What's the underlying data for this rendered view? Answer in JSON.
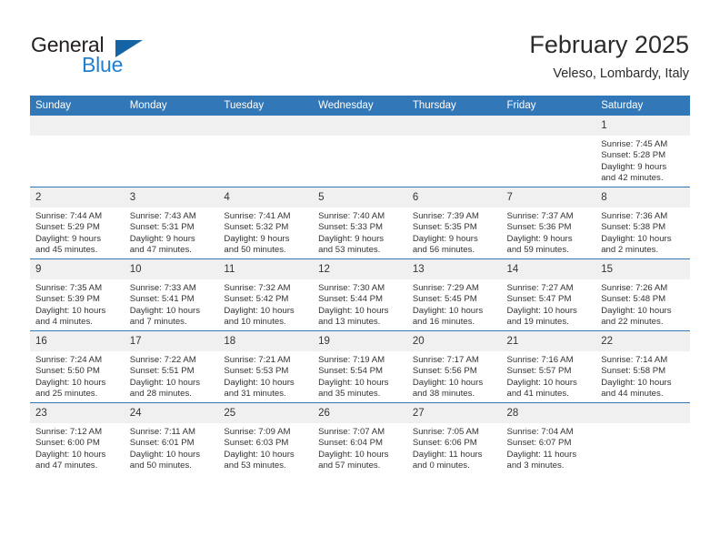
{
  "brand": {
    "name_top": "General",
    "name_bottom": "Blue",
    "triangle_color": "#1464a5",
    "blue_color": "#1f7fd0"
  },
  "header": {
    "title": "February 2025",
    "location": "Veleso, Lombardy, Italy",
    "header_bg": "#3277b8",
    "daynum_bg": "#f0f0f0"
  },
  "weekdays": [
    "Sunday",
    "Monday",
    "Tuesday",
    "Wednesday",
    "Thursday",
    "Friday",
    "Saturday"
  ],
  "weeks": [
    [
      {
        "day": "",
        "lines": []
      },
      {
        "day": "",
        "lines": []
      },
      {
        "day": "",
        "lines": []
      },
      {
        "day": "",
        "lines": []
      },
      {
        "day": "",
        "lines": []
      },
      {
        "day": "",
        "lines": []
      },
      {
        "day": "1",
        "lines": [
          "Sunrise: 7:45 AM",
          "Sunset: 5:28 PM",
          "Daylight: 9 hours",
          "and 42 minutes."
        ]
      }
    ],
    [
      {
        "day": "2",
        "lines": [
          "Sunrise: 7:44 AM",
          "Sunset: 5:29 PM",
          "Daylight: 9 hours",
          "and 45 minutes."
        ]
      },
      {
        "day": "3",
        "lines": [
          "Sunrise: 7:43 AM",
          "Sunset: 5:31 PM",
          "Daylight: 9 hours",
          "and 47 minutes."
        ]
      },
      {
        "day": "4",
        "lines": [
          "Sunrise: 7:41 AM",
          "Sunset: 5:32 PM",
          "Daylight: 9 hours",
          "and 50 minutes."
        ]
      },
      {
        "day": "5",
        "lines": [
          "Sunrise: 7:40 AM",
          "Sunset: 5:33 PM",
          "Daylight: 9 hours",
          "and 53 minutes."
        ]
      },
      {
        "day": "6",
        "lines": [
          "Sunrise: 7:39 AM",
          "Sunset: 5:35 PM",
          "Daylight: 9 hours",
          "and 56 minutes."
        ]
      },
      {
        "day": "7",
        "lines": [
          "Sunrise: 7:37 AM",
          "Sunset: 5:36 PM",
          "Daylight: 9 hours",
          "and 59 minutes."
        ]
      },
      {
        "day": "8",
        "lines": [
          "Sunrise: 7:36 AM",
          "Sunset: 5:38 PM",
          "Daylight: 10 hours",
          "and 2 minutes."
        ]
      }
    ],
    [
      {
        "day": "9",
        "lines": [
          "Sunrise: 7:35 AM",
          "Sunset: 5:39 PM",
          "Daylight: 10 hours",
          "and 4 minutes."
        ]
      },
      {
        "day": "10",
        "lines": [
          "Sunrise: 7:33 AM",
          "Sunset: 5:41 PM",
          "Daylight: 10 hours",
          "and 7 minutes."
        ]
      },
      {
        "day": "11",
        "lines": [
          "Sunrise: 7:32 AM",
          "Sunset: 5:42 PM",
          "Daylight: 10 hours",
          "and 10 minutes."
        ]
      },
      {
        "day": "12",
        "lines": [
          "Sunrise: 7:30 AM",
          "Sunset: 5:44 PM",
          "Daylight: 10 hours",
          "and 13 minutes."
        ]
      },
      {
        "day": "13",
        "lines": [
          "Sunrise: 7:29 AM",
          "Sunset: 5:45 PM",
          "Daylight: 10 hours",
          "and 16 minutes."
        ]
      },
      {
        "day": "14",
        "lines": [
          "Sunrise: 7:27 AM",
          "Sunset: 5:47 PM",
          "Daylight: 10 hours",
          "and 19 minutes."
        ]
      },
      {
        "day": "15",
        "lines": [
          "Sunrise: 7:26 AM",
          "Sunset: 5:48 PM",
          "Daylight: 10 hours",
          "and 22 minutes."
        ]
      }
    ],
    [
      {
        "day": "16",
        "lines": [
          "Sunrise: 7:24 AM",
          "Sunset: 5:50 PM",
          "Daylight: 10 hours",
          "and 25 minutes."
        ]
      },
      {
        "day": "17",
        "lines": [
          "Sunrise: 7:22 AM",
          "Sunset: 5:51 PM",
          "Daylight: 10 hours",
          "and 28 minutes."
        ]
      },
      {
        "day": "18",
        "lines": [
          "Sunrise: 7:21 AM",
          "Sunset: 5:53 PM",
          "Daylight: 10 hours",
          "and 31 minutes."
        ]
      },
      {
        "day": "19",
        "lines": [
          "Sunrise: 7:19 AM",
          "Sunset: 5:54 PM",
          "Daylight: 10 hours",
          "and 35 minutes."
        ]
      },
      {
        "day": "20",
        "lines": [
          "Sunrise: 7:17 AM",
          "Sunset: 5:56 PM",
          "Daylight: 10 hours",
          "and 38 minutes."
        ]
      },
      {
        "day": "21",
        "lines": [
          "Sunrise: 7:16 AM",
          "Sunset: 5:57 PM",
          "Daylight: 10 hours",
          "and 41 minutes."
        ]
      },
      {
        "day": "22",
        "lines": [
          "Sunrise: 7:14 AM",
          "Sunset: 5:58 PM",
          "Daylight: 10 hours",
          "and 44 minutes."
        ]
      }
    ],
    [
      {
        "day": "23",
        "lines": [
          "Sunrise: 7:12 AM",
          "Sunset: 6:00 PM",
          "Daylight: 10 hours",
          "and 47 minutes."
        ]
      },
      {
        "day": "24",
        "lines": [
          "Sunrise: 7:11 AM",
          "Sunset: 6:01 PM",
          "Daylight: 10 hours",
          "and 50 minutes."
        ]
      },
      {
        "day": "25",
        "lines": [
          "Sunrise: 7:09 AM",
          "Sunset: 6:03 PM",
          "Daylight: 10 hours",
          "and 53 minutes."
        ]
      },
      {
        "day": "26",
        "lines": [
          "Sunrise: 7:07 AM",
          "Sunset: 6:04 PM",
          "Daylight: 10 hours",
          "and 57 minutes."
        ]
      },
      {
        "day": "27",
        "lines": [
          "Sunrise: 7:05 AM",
          "Sunset: 6:06 PM",
          "Daylight: 11 hours",
          "and 0 minutes."
        ]
      },
      {
        "day": "28",
        "lines": [
          "Sunrise: 7:04 AM",
          "Sunset: 6:07 PM",
          "Daylight: 11 hours",
          "and 3 minutes."
        ]
      },
      {
        "day": "",
        "lines": []
      }
    ]
  ]
}
